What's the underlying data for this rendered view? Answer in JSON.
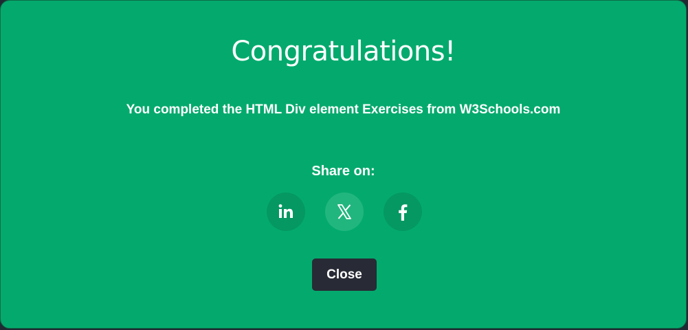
{
  "modal": {
    "title": "Congratulations!",
    "message": "You completed the HTML Div element Exercises from W3Schools.com",
    "share_label": "Share on:",
    "share_buttons": [
      {
        "icon": "linkedin-icon",
        "text": "in"
      },
      {
        "icon": "x-icon",
        "text": "𝕏"
      },
      {
        "icon": "facebook-icon",
        "text": "f"
      }
    ],
    "close_label": "Close"
  },
  "colors": {
    "background": "#04aa6d",
    "button_dark": "#282a35"
  }
}
